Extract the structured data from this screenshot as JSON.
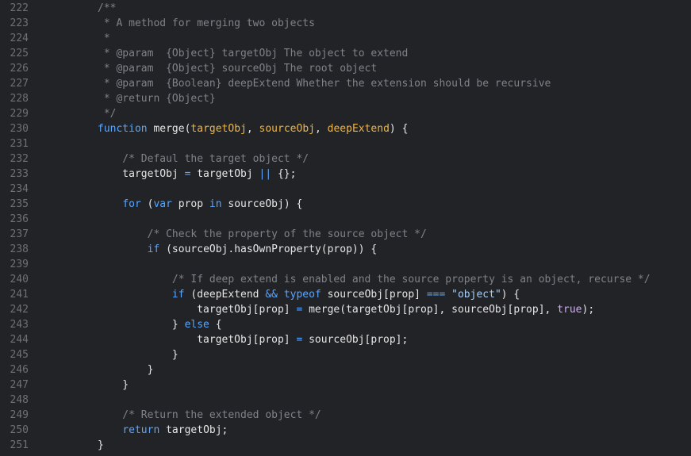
{
  "editor": {
    "language": "javascript",
    "theme": {
      "background": "#222326",
      "line_number": "#6e7074",
      "comment": "#7f8289",
      "keyword": "#58a6ff",
      "string": "#a9cef5",
      "param": "#f0b541",
      "boolean": "#d2a8ff",
      "text": "#e6e6e6"
    },
    "lines": [
      {
        "num": "222",
        "tokens": [
          {
            "t": "/**",
            "c": "comment"
          }
        ]
      },
      {
        "num": "223",
        "tokens": [
          {
            "t": " * A method for merging two objects",
            "c": "comment"
          }
        ]
      },
      {
        "num": "224",
        "tokens": [
          {
            "t": " *",
            "c": "comment"
          }
        ]
      },
      {
        "num": "225",
        "tokens": [
          {
            "t": " * @param  {Object} targetObj The object to extend",
            "c": "comment"
          }
        ]
      },
      {
        "num": "226",
        "tokens": [
          {
            "t": " * @param  {Object} sourceObj The root object",
            "c": "comment"
          }
        ]
      },
      {
        "num": "227",
        "tokens": [
          {
            "t": " * @param  {Boolean} deepExtend Whether the extension should be recursive",
            "c": "comment"
          }
        ]
      },
      {
        "num": "228",
        "tokens": [
          {
            "t": " * @return {Object}",
            "c": "comment"
          }
        ]
      },
      {
        "num": "229",
        "tokens": [
          {
            "t": " */",
            "c": "comment"
          }
        ]
      },
      {
        "num": "230",
        "tokens": [
          {
            "t": "function",
            "c": "keyword"
          },
          {
            "t": " merge(",
            "c": "default"
          },
          {
            "t": "targetObj",
            "c": "param"
          },
          {
            "t": ", ",
            "c": "default"
          },
          {
            "t": "sourceObj",
            "c": "param"
          },
          {
            "t": ", ",
            "c": "default"
          },
          {
            "t": "deepExtend",
            "c": "param"
          },
          {
            "t": ") {",
            "c": "default"
          }
        ]
      },
      {
        "num": "231",
        "tokens": []
      },
      {
        "num": "232",
        "tokens": [
          {
            "t": "    /* Defaul the target object */",
            "c": "comment"
          }
        ]
      },
      {
        "num": "233",
        "tokens": [
          {
            "t": "    targetObj ",
            "c": "default"
          },
          {
            "t": "=",
            "c": "operator"
          },
          {
            "t": " targetObj ",
            "c": "default"
          },
          {
            "t": "||",
            "c": "operator"
          },
          {
            "t": " {};",
            "c": "default"
          }
        ]
      },
      {
        "num": "234",
        "tokens": []
      },
      {
        "num": "235",
        "tokens": [
          {
            "t": "    ",
            "c": "default"
          },
          {
            "t": "for",
            "c": "keyword"
          },
          {
            "t": " (",
            "c": "default"
          },
          {
            "t": "var",
            "c": "keyword"
          },
          {
            "t": " prop ",
            "c": "default"
          },
          {
            "t": "in",
            "c": "keyword"
          },
          {
            "t": " sourceObj) {",
            "c": "default"
          }
        ]
      },
      {
        "num": "236",
        "tokens": []
      },
      {
        "num": "237",
        "tokens": [
          {
            "t": "        /* Check the property of the source object */",
            "c": "comment"
          }
        ]
      },
      {
        "num": "238",
        "tokens": [
          {
            "t": "        ",
            "c": "default"
          },
          {
            "t": "if",
            "c": "keyword"
          },
          {
            "t": " (sourceObj.hasOwnProperty(prop)) {",
            "c": "default"
          }
        ]
      },
      {
        "num": "239",
        "tokens": []
      },
      {
        "num": "240",
        "tokens": [
          {
            "t": "            /* If deep extend is enabled and the source property is an object, recurse */",
            "c": "comment"
          }
        ]
      },
      {
        "num": "241",
        "tokens": [
          {
            "t": "            ",
            "c": "default"
          },
          {
            "t": "if",
            "c": "keyword"
          },
          {
            "t": " (deepExtend ",
            "c": "default"
          },
          {
            "t": "&&",
            "c": "operator"
          },
          {
            "t": " ",
            "c": "default"
          },
          {
            "t": "typeof",
            "c": "keyword"
          },
          {
            "t": " sourceObj[prop] ",
            "c": "default"
          },
          {
            "t": "===",
            "c": "operator"
          },
          {
            "t": " ",
            "c": "default"
          },
          {
            "t": "\"object\"",
            "c": "string"
          },
          {
            "t": ") {",
            "c": "default"
          }
        ]
      },
      {
        "num": "242",
        "tokens": [
          {
            "t": "                targetObj[prop] ",
            "c": "default"
          },
          {
            "t": "=",
            "c": "operator"
          },
          {
            "t": " merge(targetObj[prop], sourceObj[prop], ",
            "c": "default"
          },
          {
            "t": "true",
            "c": "bool"
          },
          {
            "t": ");",
            "c": "default"
          }
        ]
      },
      {
        "num": "243",
        "tokens": [
          {
            "t": "            } ",
            "c": "default"
          },
          {
            "t": "else",
            "c": "keyword"
          },
          {
            "t": " {",
            "c": "default"
          }
        ]
      },
      {
        "num": "244",
        "tokens": [
          {
            "t": "                targetObj[prop] ",
            "c": "default"
          },
          {
            "t": "=",
            "c": "operator"
          },
          {
            "t": " sourceObj[prop];",
            "c": "default"
          }
        ]
      },
      {
        "num": "245",
        "tokens": [
          {
            "t": "            }",
            "c": "default"
          }
        ]
      },
      {
        "num": "246",
        "tokens": [
          {
            "t": "        }",
            "c": "default"
          }
        ]
      },
      {
        "num": "247",
        "tokens": [
          {
            "t": "    }",
            "c": "default"
          }
        ]
      },
      {
        "num": "248",
        "tokens": []
      },
      {
        "num": "249",
        "tokens": [
          {
            "t": "    /* Return the extended object */",
            "c": "comment"
          }
        ]
      },
      {
        "num": "250",
        "tokens": [
          {
            "t": "    ",
            "c": "default"
          },
          {
            "t": "return",
            "c": "keyword"
          },
          {
            "t": " targetObj;",
            "c": "default"
          }
        ]
      },
      {
        "num": "251",
        "tokens": [
          {
            "t": "}",
            "c": "default"
          }
        ]
      }
    ]
  }
}
